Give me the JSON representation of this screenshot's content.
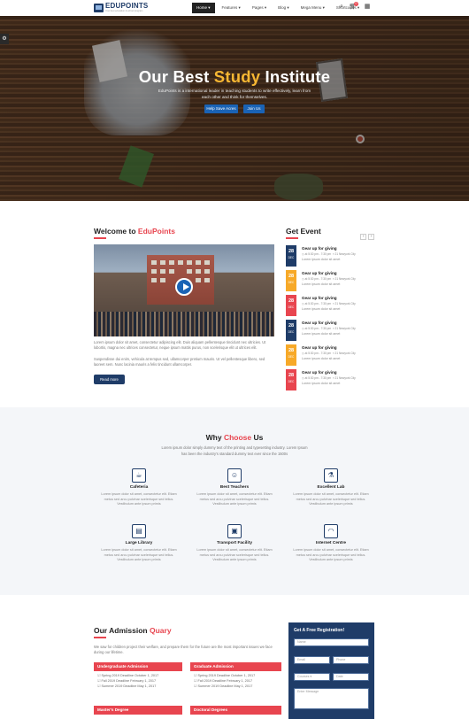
{
  "header": {
    "logo_name": "EDUPOINTS",
    "logo_tagline": "Your best education & school program",
    "nav": [
      "Home",
      "Features",
      "Pages",
      "Blog",
      "Mega Menu",
      "Shortcodes"
    ],
    "cart_count": "0",
    "icons": [
      "search-icon",
      "cart-icon",
      "grid-icon"
    ]
  },
  "hero": {
    "title_part1": "Our Best ",
    "title_accent": "Study",
    "title_part2": " Institute",
    "subtitle": "EduPoints is a international leader in teaching students to write effectively, learn from each other and think for themselves.",
    "btn_primary": "Help Save Acres",
    "btn_secondary": "Join Us",
    "accent_color": "#f7b733"
  },
  "welcome": {
    "title": "Welcome to ",
    "title_accent": "EduPoints",
    "para1": "Lorem ipsum dolor sit amet, consectetur adipiscing elit. Duis aliquam pellentesque tincidunt nec ultricies. Ut lobortis, magna nec ultrices consectetur, neque ipsum mattis purus, non scelerisque elit ut ultrices elit.",
    "para2": "Suspendisse dui enim, vehicula at tempus sed, ullamcorper pretium mauris. Ut vel pellentesque libero, sed laoreet sem. Nunc lacinia mauris a felis tincidunt ullamcorper.",
    "button": "Read more"
  },
  "events": {
    "title": "Get Event",
    "items": [
      {
        "day": "28",
        "month": "DEC",
        "color": "#1f3c68",
        "title": "Gear up for giving",
        "time": "at 5:30 pm - 7:30 pm",
        "place": "21 Newyork City",
        "desc": "Lorem ipsum dolor sit amet"
      },
      {
        "day": "28",
        "month": "DEC",
        "color": "#f7a928",
        "title": "Gear up for giving",
        "time": "at 5:30 pm - 7:30 pm",
        "place": "21 Newyork City",
        "desc": "Lorem ipsum dolor sit amet"
      },
      {
        "day": "28",
        "month": "DEC",
        "color": "#e8454f",
        "title": "Gear up for giving",
        "time": "at 5:30 pm - 7:30 pm",
        "place": "21 Newyork City",
        "desc": "Lorem ipsum dolor sit amet"
      },
      {
        "day": "28",
        "month": "DEC",
        "color": "#1f3c68",
        "title": "Gear up for giving",
        "time": "at 5:30 pm - 7:30 pm",
        "place": "21 Newyork City",
        "desc": "Lorem ipsum dolor sit amet"
      },
      {
        "day": "28",
        "month": "DEC",
        "color": "#f7a928",
        "title": "Gear up for giving",
        "time": "at 5:30 pm - 7:30 pm",
        "place": "21 Newyork City",
        "desc": "Lorem ipsum dolor sit amet"
      },
      {
        "day": "28",
        "month": "DEC",
        "color": "#e8454f",
        "title": "Gear up for giving",
        "time": "at 5:30 pm - 7:30 pm",
        "place": "21 Newyork City",
        "desc": "Lorem ipsum dolor sit amet"
      }
    ]
  },
  "why": {
    "title": "Why ",
    "title_accent": "Choose",
    "title_end": " Us",
    "subtitle_line1": "Lorem ipsum dolor simply dummy text of the printing and typesetting industry. Lorem Ipsum",
    "subtitle_line2": "has been the industry's standard dummy text ever since the 1500s",
    "features": [
      {
        "icon": "cafeteria-icon",
        "title": "Cafeteria"
      },
      {
        "icon": "teacher-icon",
        "title": "Best Teachers"
      },
      {
        "icon": "lab-icon",
        "title": "Excellent Lab"
      },
      {
        "icon": "library-icon",
        "title": "Large Library"
      },
      {
        "icon": "bus-icon",
        "title": "Transport Facility"
      },
      {
        "icon": "wifi-icon",
        "title": "Internet Centre"
      }
    ],
    "feature_desc_line1": "Lorem ipsum dolor sit amet, consectetur elit. Etiam",
    "feature_desc_line2": "metus sed arcu pulvinar scelerisque sed tellus.",
    "feature_desc_line3": "Vestibulum ante ipsum primis"
  },
  "admission": {
    "title": "Our Admission ",
    "title_accent": "Quary",
    "intro": "We saw for children project their welfare, and prepare them for the future are the most important issues we face during our lifetime.",
    "boxes": [
      {
        "title": "Undergraduate Admission",
        "items": [
          "Spring 2019 Deadline October 1, 2017",
          "Fall 2019 Deadline February 1, 2017",
          "Summer 2019 Deadline May 1, 2017"
        ]
      },
      {
        "title": "Graduate Admission",
        "items": [
          "Spring 2019 Deadline October 1, 2017",
          "Fall 2019 Deadline February 1, 2017",
          "Summer 2019 Deadline May 1, 2017"
        ]
      },
      {
        "title": "Master's Degree",
        "items": []
      },
      {
        "title": "Doctoral Degrees",
        "items": []
      }
    ]
  },
  "form": {
    "title": "Get A Free Registration!",
    "name": "Name",
    "email": "Email",
    "phone": "Phone",
    "courses": "Courses",
    "date": "Date",
    "message": "Enter Message"
  }
}
